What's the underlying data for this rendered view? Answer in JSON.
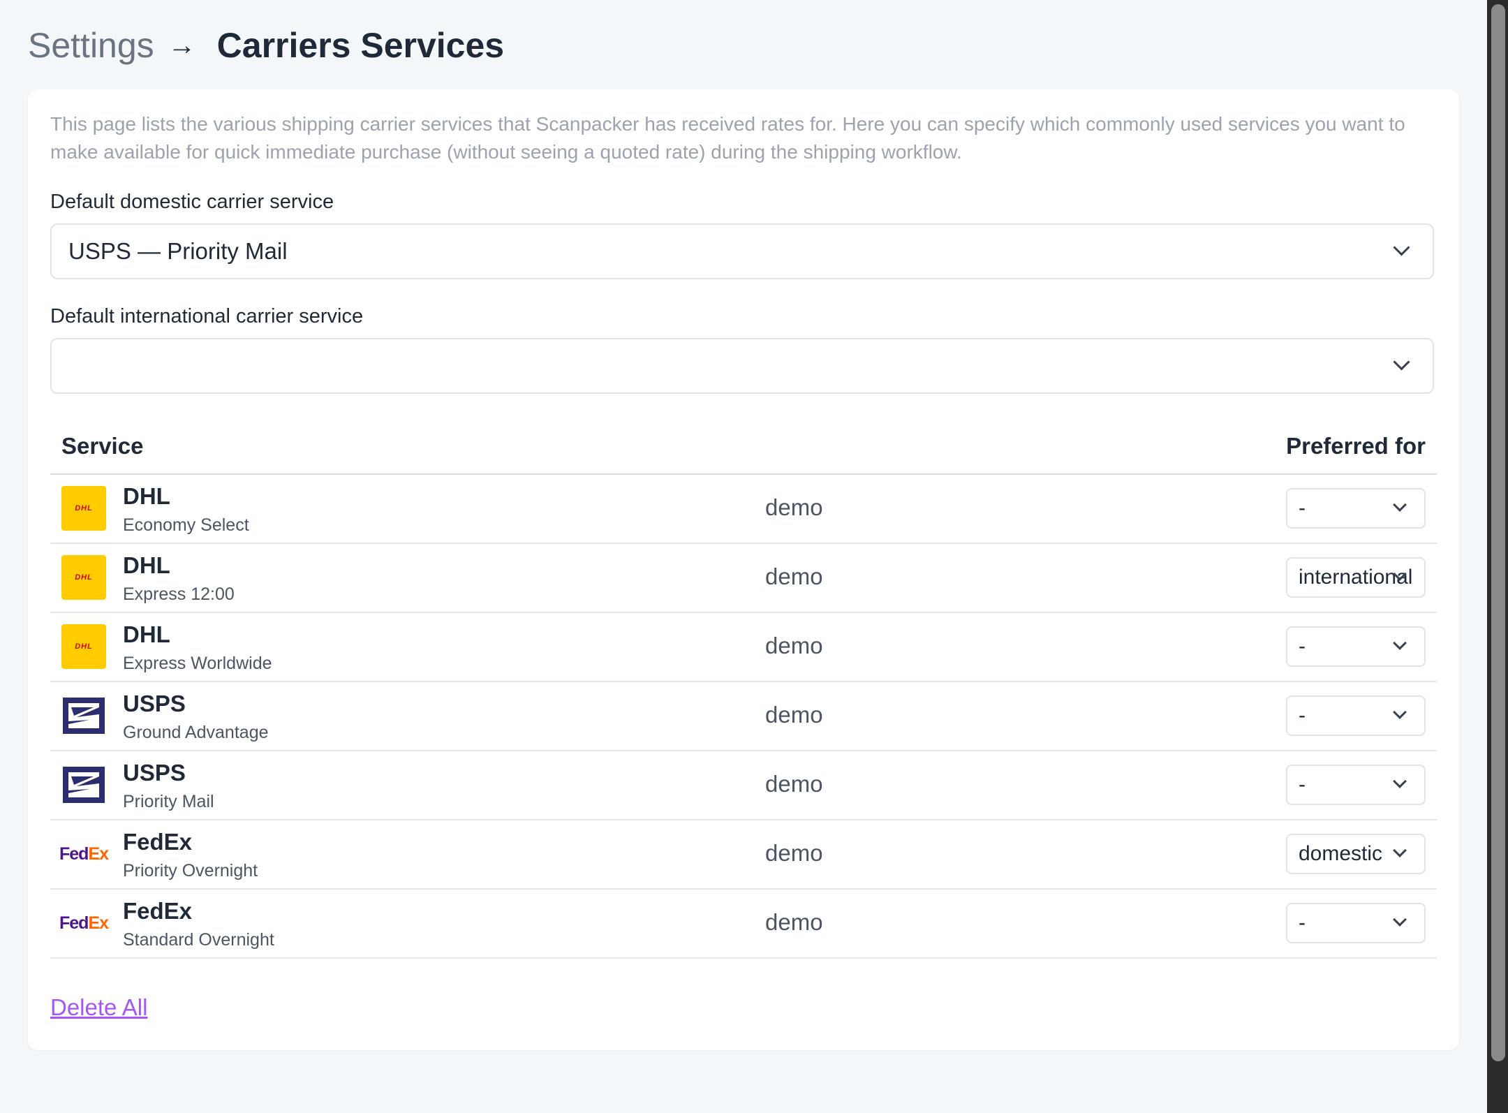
{
  "breadcrumb": {
    "parent": "Settings",
    "arrow": "→",
    "current": "Carriers Services"
  },
  "intro": "This page lists the various shipping carrier services that Scanpacker has received rates for. Here you can specify which commonly used services you want to make available for quick immediate purchase (without seeing a quoted rate) during the shipping workflow.",
  "domestic": {
    "label": "Default domestic carrier service",
    "value": "USPS — Priority Mail"
  },
  "international": {
    "label": "Default international carrier service",
    "value": ""
  },
  "table": {
    "headers": {
      "service": "Service",
      "preferred": "Preferred for"
    },
    "rows": [
      {
        "carrier": "DHL",
        "service": "Economy Select",
        "account": "demo",
        "preferred": "-",
        "logo": "dhl-logo"
      },
      {
        "carrier": "DHL",
        "service": "Express 12:00",
        "account": "demo",
        "preferred": "international",
        "logo": "dhl-logo"
      },
      {
        "carrier": "DHL",
        "service": "Express Worldwide",
        "account": "demo",
        "preferred": "-",
        "logo": "dhl-logo"
      },
      {
        "carrier": "USPS",
        "service": "Ground Advantage",
        "account": "demo",
        "preferred": "-",
        "logo": "usps-eagle-logo"
      },
      {
        "carrier": "USPS",
        "service": "Priority Mail",
        "account": "demo",
        "preferred": "-",
        "logo": "usps-eagle-logo"
      },
      {
        "carrier": "FedEx",
        "service": "Priority Overnight",
        "account": "demo",
        "preferred": "domestic",
        "logo": "fedex-logo"
      },
      {
        "carrier": "FedEx",
        "service": "Standard Overnight",
        "account": "demo",
        "preferred": "-",
        "logo": "fedex-logo"
      }
    ]
  },
  "logos": {
    "dhl": {
      "text": "DHL",
      "bg": "#ffcc00",
      "fg": "#d40511"
    },
    "usps": {
      "bg": "#2b2d6e"
    },
    "fedex": {
      "fed": "Fed",
      "ex": "Ex",
      "fed_color": "#4d148c",
      "ex_color": "#ff6600"
    }
  },
  "actions": {
    "delete_all": "Delete All"
  },
  "colors": {
    "link": "#a855f7",
    "page_bg": "#f4f7fa",
    "card_bg": "#ffffff"
  }
}
